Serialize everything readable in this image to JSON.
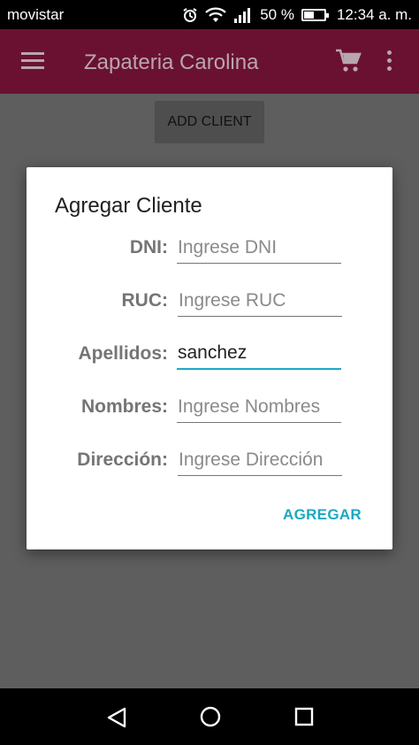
{
  "status_bar": {
    "carrier": "movistar",
    "battery_percent": "50 %",
    "battery_level": 0.5,
    "time": "12:34 a. m.",
    "icons": [
      "alarm-icon",
      "wifi-icon",
      "signal-icon",
      "battery-icon"
    ]
  },
  "app_bar": {
    "title": "Zapateria Carolina",
    "background_color": "#8c1340",
    "icons": [
      "menu-icon",
      "cart-icon",
      "more-vert-icon"
    ]
  },
  "main": {
    "add_client_label": "ADD CLIENT"
  },
  "dialog": {
    "title": "Agregar Cliente",
    "fields": [
      {
        "label": "DNI:",
        "value": "",
        "placeholder": "Ingrese DNI"
      },
      {
        "label": "RUC:",
        "value": "",
        "placeholder": "Ingrese RUC"
      },
      {
        "label": "Apellidos:",
        "value": "sanchez",
        "placeholder": ""
      },
      {
        "label": "Nombres:",
        "value": "",
        "placeholder": "Ingrese Nombres"
      },
      {
        "label": "Dirección:",
        "value": "",
        "placeholder": "Ingrese Dirección"
      }
    ],
    "submit_label": "AGREGAR",
    "accent_color": "#1ba8c2"
  },
  "nav_bar": {
    "icons": [
      "back-icon",
      "home-icon",
      "recents-icon"
    ]
  }
}
